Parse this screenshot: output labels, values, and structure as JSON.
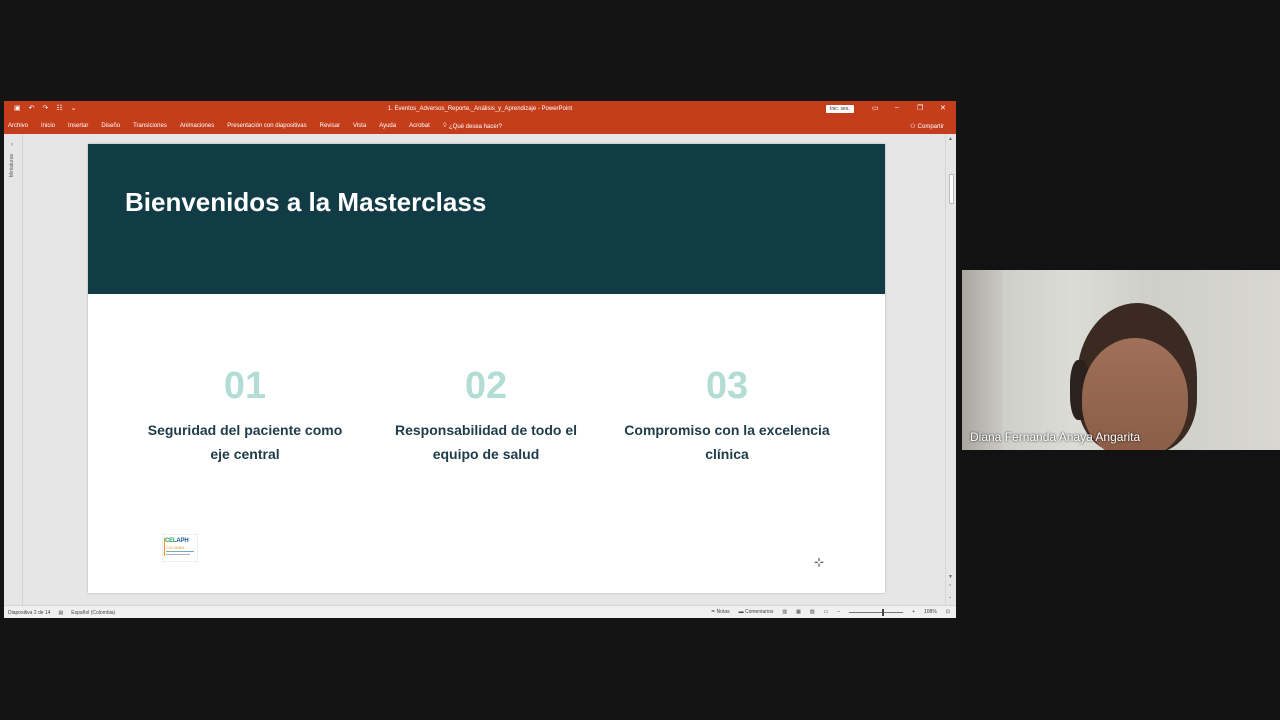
{
  "app": {
    "doc_title": "1. Eventos_Adversos_Reporte,_Análisis_y_Aprendizaje - PowerPoint",
    "signin_label": "Inic. ses.",
    "ribbon_tabs": [
      "Archivo",
      "Inicio",
      "Insertar",
      "Diseño",
      "Transiciones",
      "Animaciones",
      "Presentación con diapositivas",
      "Revisar",
      "Vista",
      "Ayuda",
      "Acrobat"
    ],
    "tell_me": "¿Qué desea hacer?",
    "share_label": "Compartir",
    "left_pane_label": "Miniaturas",
    "accent_color": "#c43e1c"
  },
  "slide": {
    "title": "Bienvenidos a la Masterclass",
    "header_color": "#113b45",
    "number_color": "#b3ddd4",
    "columns": [
      {
        "number": "01",
        "line1": "Seguridad del paciente como",
        "line2": "eje central"
      },
      {
        "number": "02",
        "line1": "Responsabilidad de todo el",
        "line2": "equipo de salud"
      },
      {
        "number": "03",
        "line1": "Compromiso con la excelencia",
        "line2": "clínica"
      }
    ],
    "logo": {
      "text_a": "CEL",
      "text_b": "APH",
      "text_c": "COLOMBIA"
    }
  },
  "status": {
    "slide_counter": "Diapositiva 2 de 14",
    "language": "Español (Colombia)",
    "notes": "Notas",
    "comments": "Comentarios",
    "zoom": "108%"
  },
  "video": {
    "participant_name": "Diana Fernanda Anaya Angarita"
  }
}
